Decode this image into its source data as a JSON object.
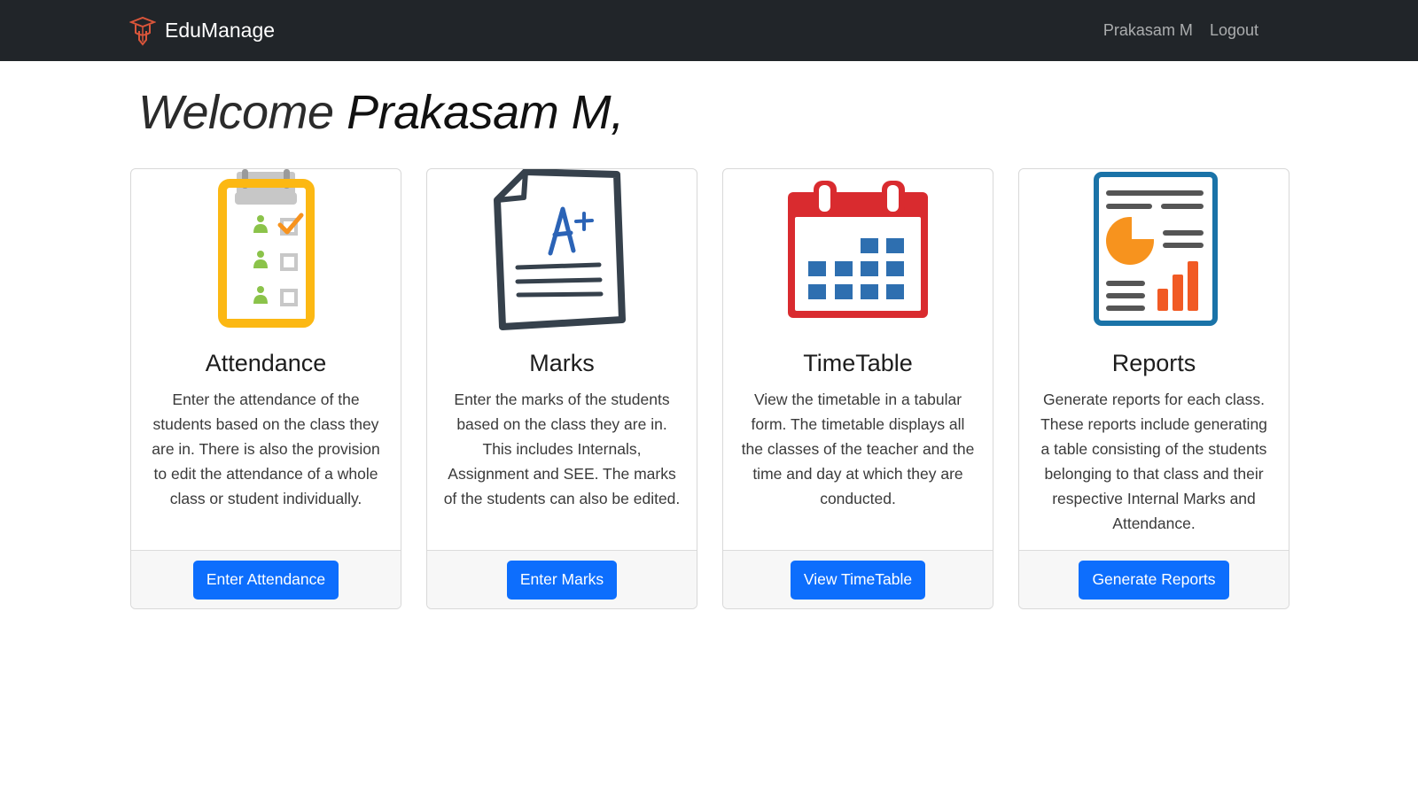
{
  "app": {
    "name": "EduManage",
    "logo_icon": "graduation-cap-icon",
    "colors": {
      "navbar": "#212529",
      "primary_button": "#0d6efd"
    }
  },
  "nav": {
    "user_name": "Prakasam M",
    "logout_label": "Logout"
  },
  "welcome": {
    "prefix": "Welcome",
    "name": "Prakasam M,"
  },
  "cards": [
    {
      "icon": "attendance-clipboard-icon",
      "title": "Attendance",
      "text": "Enter the attendance of the students based on the class they are in. There is also the provision to edit the attendance of a whole class or student individually.",
      "button": "Enter Attendance"
    },
    {
      "icon": "marks-paper-icon",
      "title": "Marks",
      "text": "Enter the marks of the students based on the class they are in. This includes Internals, Assignment and SEE. The marks of the students can also be edited.",
      "button": "Enter Marks"
    },
    {
      "icon": "calendar-icon",
      "title": "TimeTable",
      "text": "View the timetable in a tabular form. The timetable displays all the classes of the teacher and the time and day at which they are conducted.",
      "button": "View TimeTable"
    },
    {
      "icon": "report-chart-icon",
      "title": "Reports",
      "text": "Generate reports for each class. These reports include generating a table consisting of the students belonging to that class and their respective Internal Marks and Attendance.",
      "button": "Generate Reports"
    }
  ]
}
